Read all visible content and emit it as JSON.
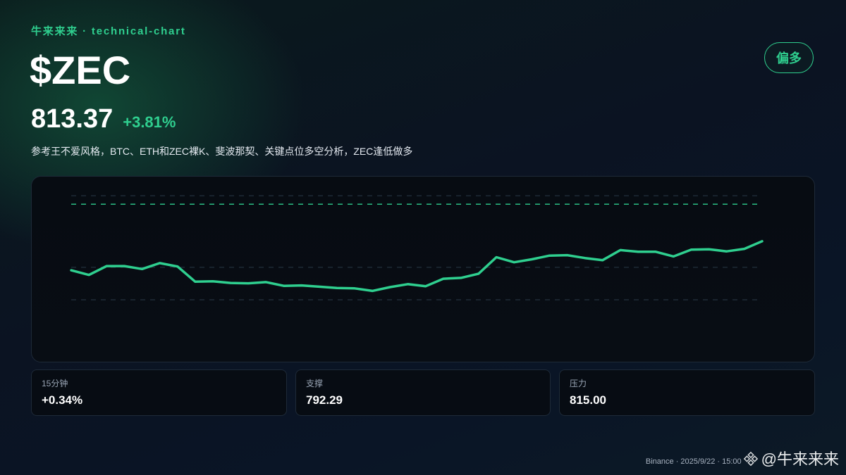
{
  "header": {
    "brand": "牛来来来 · technical-chart",
    "ticker": "$ZEC",
    "bias_badge": "偏多",
    "price": "813.37",
    "change": "+3.81%",
    "subtitle": "参考王不爱风格，BTC、ETH和ZEC裸K、斐波那契、关键点位多空分析，ZEC逢低做多"
  },
  "stats": [
    {
      "label": "15分钟",
      "value": "+0.34%"
    },
    {
      "label": "支撑",
      "value": "792.29"
    },
    {
      "label": "压力",
      "value": "815.00"
    }
  ],
  "footer": {
    "source": "Binance · 2025/9/22 · 15:00",
    "watermark_icon": "binance-diamond-icon",
    "watermark_handle": "@牛来来来"
  },
  "colors": {
    "accent": "#2fcf8f",
    "line": "#2fcf8f",
    "grid": "#2a3a48"
  },
  "chart_data": {
    "type": "line",
    "title": "",
    "xlabel": "",
    "ylabel": "",
    "grid": true,
    "ylim": [
      780.6,
      818.2
    ],
    "reference_lines": [
      {
        "value": 815.0,
        "label": "压力",
        "style": "dashed",
        "color": "#2fcf8f"
      },
      {
        "value": 817.0,
        "style": "dashed",
        "color": "#2a3a48"
      },
      {
        "value": 800.0,
        "style": "dashed",
        "color": "#2a3a48"
      },
      {
        "value": 792.29,
        "label": "支撑",
        "style": "dashed",
        "color": "#2a3a48"
      }
    ],
    "series": [
      {
        "values": [
          799.3,
          798.2,
          800.3,
          800.3,
          799.6,
          801.0,
          800.2,
          796.6,
          796.7,
          796.3,
          796.2,
          796.5,
          795.6,
          795.7,
          795.4,
          795.1,
          795.0,
          794.4,
          795.3,
          796.0,
          795.5,
          797.3,
          797.5,
          798.5,
          802.4,
          801.2,
          801.9,
          802.8,
          802.9,
          802.2,
          801.7,
          804.1,
          803.7,
          803.7,
          802.6,
          804.2,
          804.3,
          803.8,
          804.4,
          806.2
        ]
      }
    ]
  }
}
